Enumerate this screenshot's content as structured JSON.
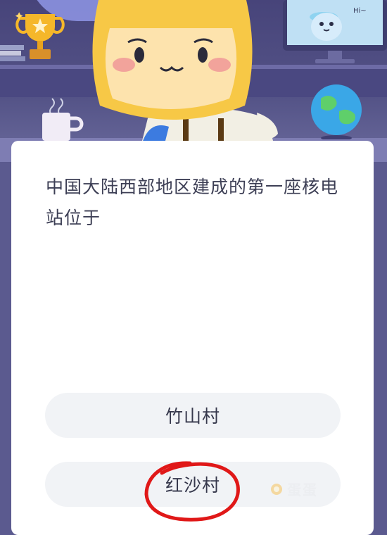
{
  "quiz": {
    "question": "中国大陆西部地区建成的第一座核电站位于",
    "options": [
      {
        "label": "竹山村"
      },
      {
        "label": "红沙村"
      }
    ]
  },
  "watermark": {
    "text": "蛋蛋"
  },
  "scene": {
    "monitor_text": "Hi~"
  },
  "colors": {
    "background": "#5b5a8f",
    "card": "#ffffff",
    "option_bg": "#f1f3f6",
    "annotation_red": "#e01818"
  }
}
